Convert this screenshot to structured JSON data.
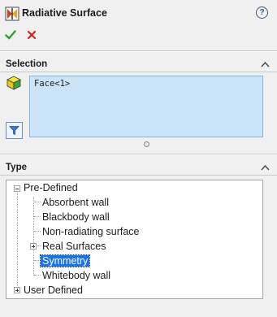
{
  "header": {
    "title": "Radiative Surface",
    "help_icon": "help-circle-icon",
    "help_symbol": "?",
    "ok_icon": "checkmark-icon",
    "cancel_icon": "red-x-icon"
  },
  "selection": {
    "heading": "Selection",
    "items": [
      "Face<1>"
    ],
    "filter_icon": "filter-icon"
  },
  "type": {
    "heading": "Type",
    "tree": [
      {
        "label": "Pre-Defined",
        "expanded": true,
        "children": [
          {
            "label": "Absorbent wall"
          },
          {
            "label": "Blackbody wall"
          },
          {
            "label": "Non-radiating surface"
          },
          {
            "label": "Real Surfaces",
            "expanded": false
          },
          {
            "label": "Symmetry",
            "selected": true
          },
          {
            "label": "Whitebody wall"
          }
        ]
      },
      {
        "label": "User Defined",
        "expanded": false
      }
    ]
  },
  "colors": {
    "selection_fill": "#cce4f7",
    "selection_border": "#7eb4ea",
    "tree_selected": "#1a73e8",
    "ok_green": "#2e9e2e",
    "cancel_red": "#d02020"
  }
}
